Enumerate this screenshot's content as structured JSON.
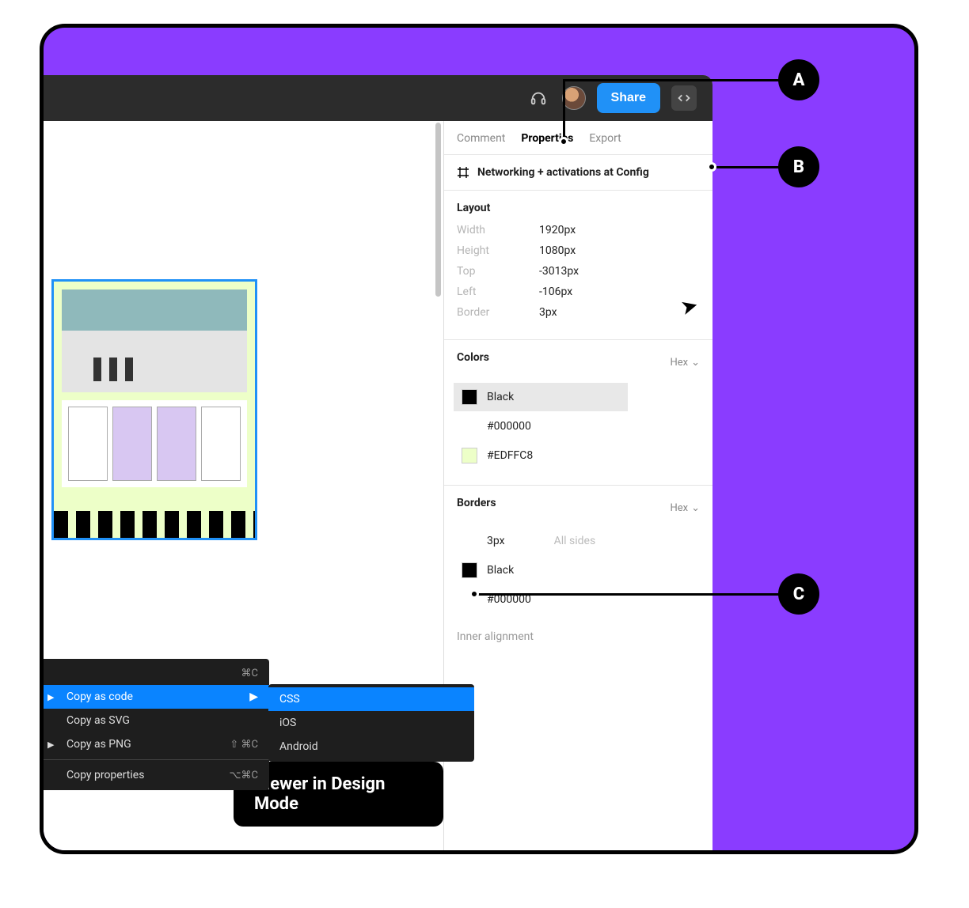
{
  "toolbar": {
    "share_label": "Share"
  },
  "panel": {
    "tabs": {
      "comment": "Comment",
      "properties": "Properties",
      "export": "Export"
    },
    "frame_name": "Networking + activations at Config",
    "layout": {
      "title": "Layout",
      "rows": [
        {
          "k": "Width",
          "v": "1920px"
        },
        {
          "k": "Height",
          "v": "1080px"
        },
        {
          "k": "Top",
          "v": "-3013px"
        },
        {
          "k": "Left",
          "v": "-106px"
        },
        {
          "k": "Border",
          "v": "3px"
        }
      ]
    },
    "colors": {
      "title": "Colors",
      "format": "Hex",
      "items": [
        {
          "name": "Black",
          "hex": "#000000",
          "swatch": "#000000"
        },
        {
          "name": "",
          "hex": "#EDFFC8",
          "swatch": "#EDFFC8"
        }
      ]
    },
    "borders": {
      "title": "Borders",
      "format": "Hex",
      "size": "3px",
      "sides": "All sides",
      "color_name": "Black",
      "color_hex": "#000000"
    },
    "inner_alignment": "Inner alignment"
  },
  "context_menu": {
    "shortcut_copy": "⌘C",
    "items": {
      "copy_as_code": "Copy as code",
      "copy_as_svg": "Copy as SVG",
      "copy_as_png": "Copy as PNG",
      "copy_as_png_shortcut": "⇧ ⌘C",
      "copy_properties": "Copy properties",
      "copy_properties_shortcut": "⌥⌘C"
    },
    "submenu": {
      "css": "CSS",
      "ios": "iOS",
      "android": "Android"
    }
  },
  "caption": "Viewer in Design Mode",
  "annotations": {
    "a": "A",
    "b": "B",
    "c": "C"
  }
}
